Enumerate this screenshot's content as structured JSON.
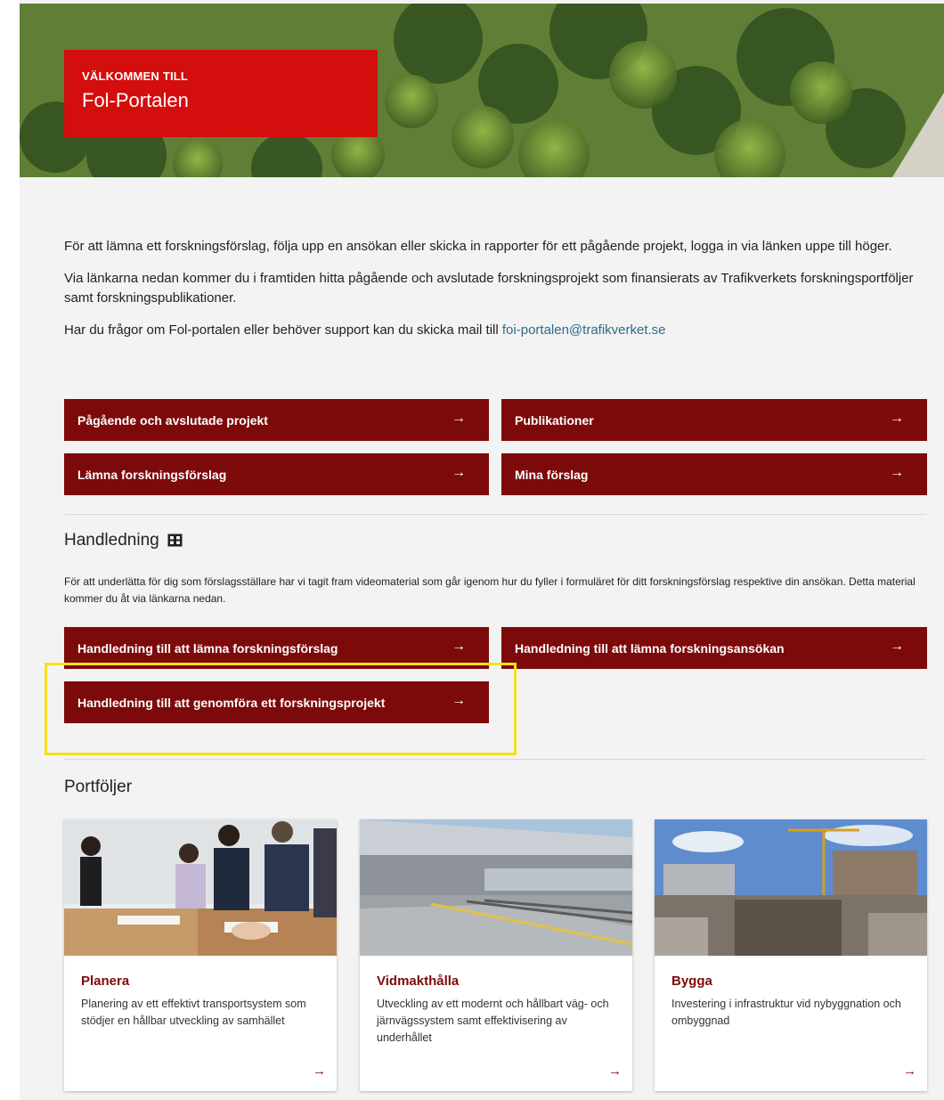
{
  "hero": {
    "kicker": "VÄLKOMMEN TILL",
    "title": "Fol-Portalen"
  },
  "intro": {
    "p1": "För att lämna ett forskningsförslag, följa upp en ansökan eller skicka in rapporter för ett pågående projekt, logga in via länken uppe till höger.",
    "p2": "Via länkarna nedan kommer du i framtiden hitta pågående och avslutade forskningsprojekt som finansierats av Trafikverkets forskningsportföljer samt forskningspublikationer.",
    "p3_prefix": "Har du frågor om Fol-portalen eller behöver support kan du skicka mail till ",
    "email": "foi-portalen@trafikverket.se"
  },
  "main_buttons": [
    {
      "label": "Pågående och avslutade projekt"
    },
    {
      "label": "Publikationer"
    },
    {
      "label": "Lämna forskningsförslag"
    },
    {
      "label": "Mina förslag"
    }
  ],
  "guide": {
    "title": "Handledning",
    "text": "För att underlätta för dig som förslagsställare har vi tagit fram videomaterial som går igenom hur du fyller i formuläret för ditt forskningsförslag respektive din ansökan. Detta material kommer du åt via länkarna nedan.",
    "buttons": [
      {
        "label": "Handledning till att lämna forskningsförslag"
      },
      {
        "label": "Handledning till att lämna forskningsansökan"
      },
      {
        "label": "Handledning till att genomföra ett forskningsprojekt"
      }
    ]
  },
  "portfolios": {
    "title": "Portföljer",
    "cards": [
      {
        "title": "Planera",
        "desc": "Planering av ett effektivt transportsystem som stödjer en hållbar utveckling av samhället"
      },
      {
        "title": "Vidmakthålla",
        "desc": "Utveckling av ett modernt och hållbart väg- och järnvägssystem samt effektivisering av underhållet"
      },
      {
        "title": "Bygga",
        "desc": "Investering i infrastruktur vid nybyggnation och ombyggnad"
      }
    ]
  },
  "colors": {
    "brand_red": "#d40d0d",
    "button_dark_red": "#7d0a0a",
    "link_blue": "#2c6c8c",
    "highlight_yellow": "#f3e21a"
  },
  "icons": {
    "arrow": "→",
    "film": "film-icon"
  }
}
